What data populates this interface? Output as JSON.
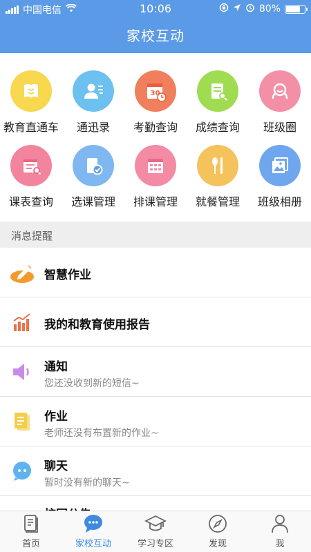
{
  "status_bar": {
    "carrier": "中国电信",
    "time": "10:06",
    "battery": "80%",
    "battery_level": 0.8
  },
  "header": {
    "title": "家校互动"
  },
  "grid": [
    {
      "label": "教育直通车",
      "icon": "book-icon",
      "color": "#f7d84e"
    },
    {
      "label": "通迅录",
      "icon": "contacts-icon",
      "color": "#6cc1f0"
    },
    {
      "label": "考勤查询",
      "icon": "calendar-clock-icon",
      "color": "#f07f5d"
    },
    {
      "label": "成绩查询",
      "icon": "report-search-icon",
      "color": "#9fdc52"
    },
    {
      "label": "班级圈",
      "icon": "class-circle-icon",
      "color": "#f48fa8"
    },
    {
      "label": "课表查询",
      "icon": "schedule-search-icon",
      "color": "#f3849d"
    },
    {
      "label": "选课管理",
      "icon": "course-select-icon",
      "color": "#7fb7f0"
    },
    {
      "label": "排课管理",
      "icon": "calendar-grid-icon",
      "color": "#f48aa4"
    },
    {
      "label": "就餐管理",
      "icon": "spoon-knife-icon",
      "color": "#f4c35c"
    },
    {
      "label": "班级相册",
      "icon": "photo-album-icon",
      "color": "#6fa7ee"
    }
  ],
  "section": {
    "title": "消息提醒"
  },
  "list": [
    {
      "title": "智慧作业",
      "subtitle": "",
      "icon": "pencil-icon",
      "color": "#f39a2d"
    },
    {
      "title": "我的和教育使用报告",
      "subtitle": "",
      "icon": "bar-chart-icon",
      "color": "#e8734a"
    },
    {
      "title": "通知",
      "subtitle": "您还没收到新的短信~",
      "icon": "speaker-icon",
      "color": "#c98bea"
    },
    {
      "title": "作业",
      "subtitle": "老师还没有布置新的作业~",
      "icon": "homework-icon",
      "color": "#f2cf4a"
    },
    {
      "title": "聊天",
      "subtitle": "暂时没有新的聊天~",
      "icon": "chat-icon",
      "color": "#5fb4ef"
    },
    {
      "title": "校园公告",
      "subtitle": "",
      "icon": "announcement-icon",
      "color": "#f2cf4a"
    }
  ],
  "tabs": [
    {
      "label": "首页",
      "icon": "home-doc-icon",
      "active": false
    },
    {
      "label": "家校互动",
      "icon": "chat-bubble-icon",
      "active": true
    },
    {
      "label": "学习专区",
      "icon": "graduation-cap-icon",
      "active": false
    },
    {
      "label": "发现",
      "icon": "compass-icon",
      "active": false
    },
    {
      "label": "我",
      "icon": "person-icon",
      "active": false
    }
  ],
  "colors": {
    "header": "#5b9ae6",
    "active_tab": "#3d8be0"
  }
}
